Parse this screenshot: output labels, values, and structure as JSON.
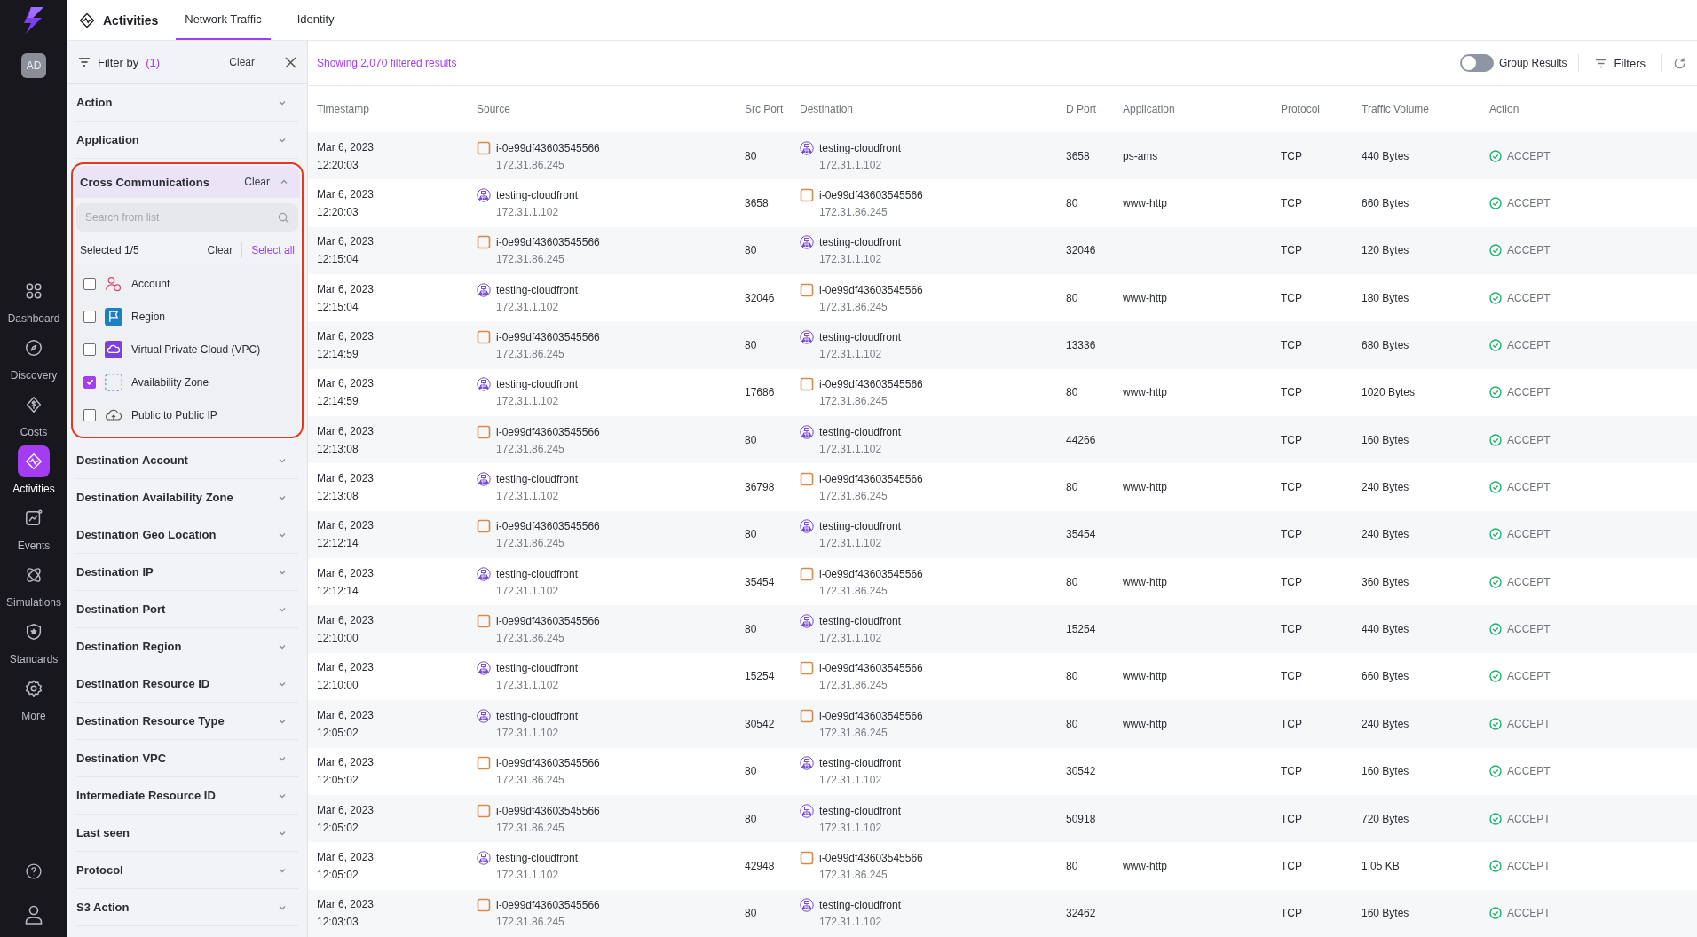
{
  "nav": {
    "avatar": "AD",
    "items": [
      {
        "kind": "dashboard",
        "label": "Dashboard",
        "selected": false
      },
      {
        "kind": "discovery",
        "label": "Discovery",
        "selected": false
      },
      {
        "kind": "costs",
        "label": "Costs",
        "selected": false
      },
      {
        "kind": "activities",
        "label": "Activities",
        "selected": true
      },
      {
        "kind": "events",
        "label": "Events",
        "selected": false
      },
      {
        "kind": "simulations",
        "label": "Simulations",
        "selected": false
      },
      {
        "kind": "standards",
        "label": "Standards",
        "selected": false
      },
      {
        "kind": "more",
        "label": "More",
        "selected": false
      }
    ]
  },
  "header": {
    "title": "Activities",
    "tabs": [
      {
        "label": "Network Traffic",
        "selected": true
      },
      {
        "label": "Identity",
        "selected": false
      }
    ]
  },
  "filter": {
    "title": "Filter by",
    "count": "(1)",
    "clear": "Clear",
    "sections": [
      {
        "label": "Action",
        "expanded": false
      },
      {
        "label": "Application",
        "expanded": false
      },
      {
        "label": "Cross Communications",
        "expanded": true,
        "highlighted": true,
        "clear": "Clear",
        "search_placeholder": "Search from list",
        "selected_count": "Selected 1/5",
        "clear_selection": "Clear",
        "select_all": "Select all",
        "options": [
          {
            "kind": "account",
            "label": "Account",
            "checked": false
          },
          {
            "kind": "region",
            "label": "Region",
            "checked": false
          },
          {
            "kind": "vpc",
            "label": "Virtual Private Cloud (VPC)",
            "checked": false
          },
          {
            "kind": "zone",
            "label": "Availability Zone",
            "checked": true
          },
          {
            "kind": "publicip",
            "label": "Public to Public IP",
            "checked": false
          }
        ]
      },
      {
        "label": "Destination Account",
        "expanded": false
      },
      {
        "label": "Destination Availability Zone",
        "expanded": false
      },
      {
        "label": "Destination Geo Location",
        "expanded": false
      },
      {
        "label": "Destination IP",
        "expanded": false
      },
      {
        "label": "Destination Port",
        "expanded": false
      },
      {
        "label": "Destination Region",
        "expanded": false
      },
      {
        "label": "Destination Resource ID",
        "expanded": false
      },
      {
        "label": "Destination Resource Type",
        "expanded": false
      },
      {
        "label": "Destination VPC",
        "expanded": false
      },
      {
        "label": "Intermediate Resource ID",
        "expanded": false
      },
      {
        "label": "Last seen",
        "expanded": false
      },
      {
        "label": "Protocol",
        "expanded": false
      },
      {
        "label": "S3 Action",
        "expanded": false
      }
    ]
  },
  "toolbar": {
    "results": "Showing 2,070 filtered results",
    "group_results": {
      "label": "Group Results",
      "on": false
    },
    "filters": "Filters"
  },
  "table": {
    "columns": [
      "Timestamp",
      "Source",
      "Src Port",
      "Destination",
      "D Port",
      "Application",
      "Protocol",
      "Traffic Volume",
      "Action"
    ],
    "rows": [
      {
        "date": "Mar 6, 2023",
        "time": "12:20:03",
        "source": {
          "kind": "instance",
          "name": "i-0e99df43603545566",
          "ip": "172.31.86.245"
        },
        "src_port": "80",
        "destination": {
          "kind": "cloudfront",
          "name": "testing-cloudfront",
          "ip": "172.31.1.102"
        },
        "d_port": "3658",
        "application": "ps-ams",
        "protocol": "TCP",
        "volume": "440 Bytes",
        "action": "ACCEPT"
      },
      {
        "date": "Mar 6, 2023",
        "time": "12:20:03",
        "source": {
          "kind": "cloudfront",
          "name": "testing-cloudfront",
          "ip": "172.31.1.102"
        },
        "src_port": "3658",
        "destination": {
          "kind": "instance",
          "name": "i-0e99df43603545566",
          "ip": "172.31.86.245"
        },
        "d_port": "80",
        "application": "www-http",
        "protocol": "TCP",
        "volume": "660 Bytes",
        "action": "ACCEPT"
      },
      {
        "date": "Mar 6, 2023",
        "time": "12:15:04",
        "source": {
          "kind": "instance",
          "name": "i-0e99df43603545566",
          "ip": "172.31.86.245"
        },
        "src_port": "80",
        "destination": {
          "kind": "cloudfront",
          "name": "testing-cloudfront",
          "ip": "172.31.1.102"
        },
        "d_port": "32046",
        "protocol": "TCP",
        "volume": "120 Bytes",
        "action": "ACCEPT"
      },
      {
        "date": "Mar 6, 2023",
        "time": "12:15:04",
        "source": {
          "kind": "cloudfront",
          "name": "testing-cloudfront",
          "ip": "172.31.1.102"
        },
        "src_port": "32046",
        "destination": {
          "kind": "instance",
          "name": "i-0e99df43603545566",
          "ip": "172.31.86.245"
        },
        "d_port": "80",
        "application": "www-http",
        "protocol": "TCP",
        "volume": "180 Bytes",
        "action": "ACCEPT"
      },
      {
        "date": "Mar 6, 2023",
        "time": "12:14:59",
        "source": {
          "kind": "instance",
          "name": "i-0e99df43603545566",
          "ip": "172.31.86.245"
        },
        "src_port": "80",
        "destination": {
          "kind": "cloudfront",
          "name": "testing-cloudfront",
          "ip": "172.31.1.102"
        },
        "d_port": "13336",
        "protocol": "TCP",
        "volume": "680 Bytes",
        "action": "ACCEPT"
      },
      {
        "date": "Mar 6, 2023",
        "time": "12:14:59",
        "source": {
          "kind": "cloudfront",
          "name": "testing-cloudfront",
          "ip": "172.31.1.102"
        },
        "src_port": "17686",
        "destination": {
          "kind": "instance",
          "name": "i-0e99df43603545566",
          "ip": "172.31.86.245"
        },
        "d_port": "80",
        "application": "www-http",
        "protocol": "TCP",
        "volume": "1020 Bytes",
        "action": "ACCEPT"
      },
      {
        "date": "Mar 6, 2023",
        "time": "12:13:08",
        "source": {
          "kind": "instance",
          "name": "i-0e99df43603545566",
          "ip": "172.31.86.245"
        },
        "src_port": "80",
        "destination": {
          "kind": "cloudfront",
          "name": "testing-cloudfront",
          "ip": "172.31.1.102"
        },
        "d_port": "44266",
        "protocol": "TCP",
        "volume": "160 Bytes",
        "action": "ACCEPT"
      },
      {
        "date": "Mar 6, 2023",
        "time": "12:13:08",
        "source": {
          "kind": "cloudfront",
          "name": "testing-cloudfront",
          "ip": "172.31.1.102"
        },
        "src_port": "36798",
        "destination": {
          "kind": "instance",
          "name": "i-0e99df43603545566",
          "ip": "172.31.86.245"
        },
        "d_port": "80",
        "application": "www-http",
        "protocol": "TCP",
        "volume": "240 Bytes",
        "action": "ACCEPT"
      },
      {
        "date": "Mar 6, 2023",
        "time": "12:12:14",
        "source": {
          "kind": "instance",
          "name": "i-0e99df43603545566",
          "ip": "172.31.86.245"
        },
        "src_port": "80",
        "destination": {
          "kind": "cloudfront",
          "name": "testing-cloudfront",
          "ip": "172.31.1.102"
        },
        "d_port": "35454",
        "protocol": "TCP",
        "volume": "240 Bytes",
        "action": "ACCEPT"
      },
      {
        "date": "Mar 6, 2023",
        "time": "12:12:14",
        "source": {
          "kind": "cloudfront",
          "name": "testing-cloudfront",
          "ip": "172.31.1.102"
        },
        "src_port": "35454",
        "destination": {
          "kind": "instance",
          "name": "i-0e99df43603545566",
          "ip": "172.31.86.245"
        },
        "d_port": "80",
        "application": "www-http",
        "protocol": "TCP",
        "volume": "360 Bytes",
        "action": "ACCEPT"
      },
      {
        "date": "Mar 6, 2023",
        "time": "12:10:00",
        "source": {
          "kind": "instance",
          "name": "i-0e99df43603545566",
          "ip": "172.31.86.245"
        },
        "src_port": "80",
        "destination": {
          "kind": "cloudfront",
          "name": "testing-cloudfront",
          "ip": "172.31.1.102"
        },
        "d_port": "15254",
        "protocol": "TCP",
        "volume": "440 Bytes",
        "action": "ACCEPT"
      },
      {
        "date": "Mar 6, 2023",
        "time": "12:10:00",
        "source": {
          "kind": "cloudfront",
          "name": "testing-cloudfront",
          "ip": "172.31.1.102"
        },
        "src_port": "15254",
        "destination": {
          "kind": "instance",
          "name": "i-0e99df43603545566",
          "ip": "172.31.86.245"
        },
        "d_port": "80",
        "application": "www-http",
        "protocol": "TCP",
        "volume": "660 Bytes",
        "action": "ACCEPT"
      },
      {
        "date": "Mar 6, 2023",
        "time": "12:05:02",
        "source": {
          "kind": "cloudfront",
          "name": "testing-cloudfront",
          "ip": "172.31.1.102"
        },
        "src_port": "30542",
        "destination": {
          "kind": "instance",
          "name": "i-0e99df43603545566",
          "ip": "172.31.86.245"
        },
        "d_port": "80",
        "application": "www-http",
        "protocol": "TCP",
        "volume": "240 Bytes",
        "action": "ACCEPT"
      },
      {
        "date": "Mar 6, 2023",
        "time": "12:05:02",
        "source": {
          "kind": "instance",
          "name": "i-0e99df43603545566",
          "ip": "172.31.86.245"
        },
        "src_port": "80",
        "destination": {
          "kind": "cloudfront",
          "name": "testing-cloudfront",
          "ip": "172.31.1.102"
        },
        "d_port": "30542",
        "protocol": "TCP",
        "volume": "160 Bytes",
        "action": "ACCEPT"
      },
      {
        "date": "Mar 6, 2023",
        "time": "12:05:02",
        "source": {
          "kind": "instance",
          "name": "i-0e99df43603545566",
          "ip": "172.31.86.245"
        },
        "src_port": "80",
        "destination": {
          "kind": "cloudfront",
          "name": "testing-cloudfront",
          "ip": "172.31.1.102"
        },
        "d_port": "50918",
        "protocol": "TCP",
        "volume": "720 Bytes",
        "action": "ACCEPT"
      },
      {
        "date": "Mar 6, 2023",
        "time": "12:05:02",
        "source": {
          "kind": "cloudfront",
          "name": "testing-cloudfront",
          "ip": "172.31.1.102"
        },
        "src_port": "42948",
        "destination": {
          "kind": "instance",
          "name": "i-0e99df43603545566",
          "ip": "172.31.86.245"
        },
        "d_port": "80",
        "application": "www-http",
        "protocol": "TCP",
        "volume": "1.05 KB",
        "action": "ACCEPT"
      },
      {
        "date": "Mar 6, 2023",
        "time": "12:03:03",
        "source": {
          "kind": "instance",
          "name": "i-0e99df43603545566",
          "ip": "172.31.86.245"
        },
        "src_port": "80",
        "destination": {
          "kind": "cloudfront",
          "name": "testing-cloudfront",
          "ip": "172.31.1.102"
        },
        "d_port": "32462",
        "protocol": "TCP",
        "volume": "160 Bytes",
        "action": "ACCEPT"
      }
    ]
  }
}
